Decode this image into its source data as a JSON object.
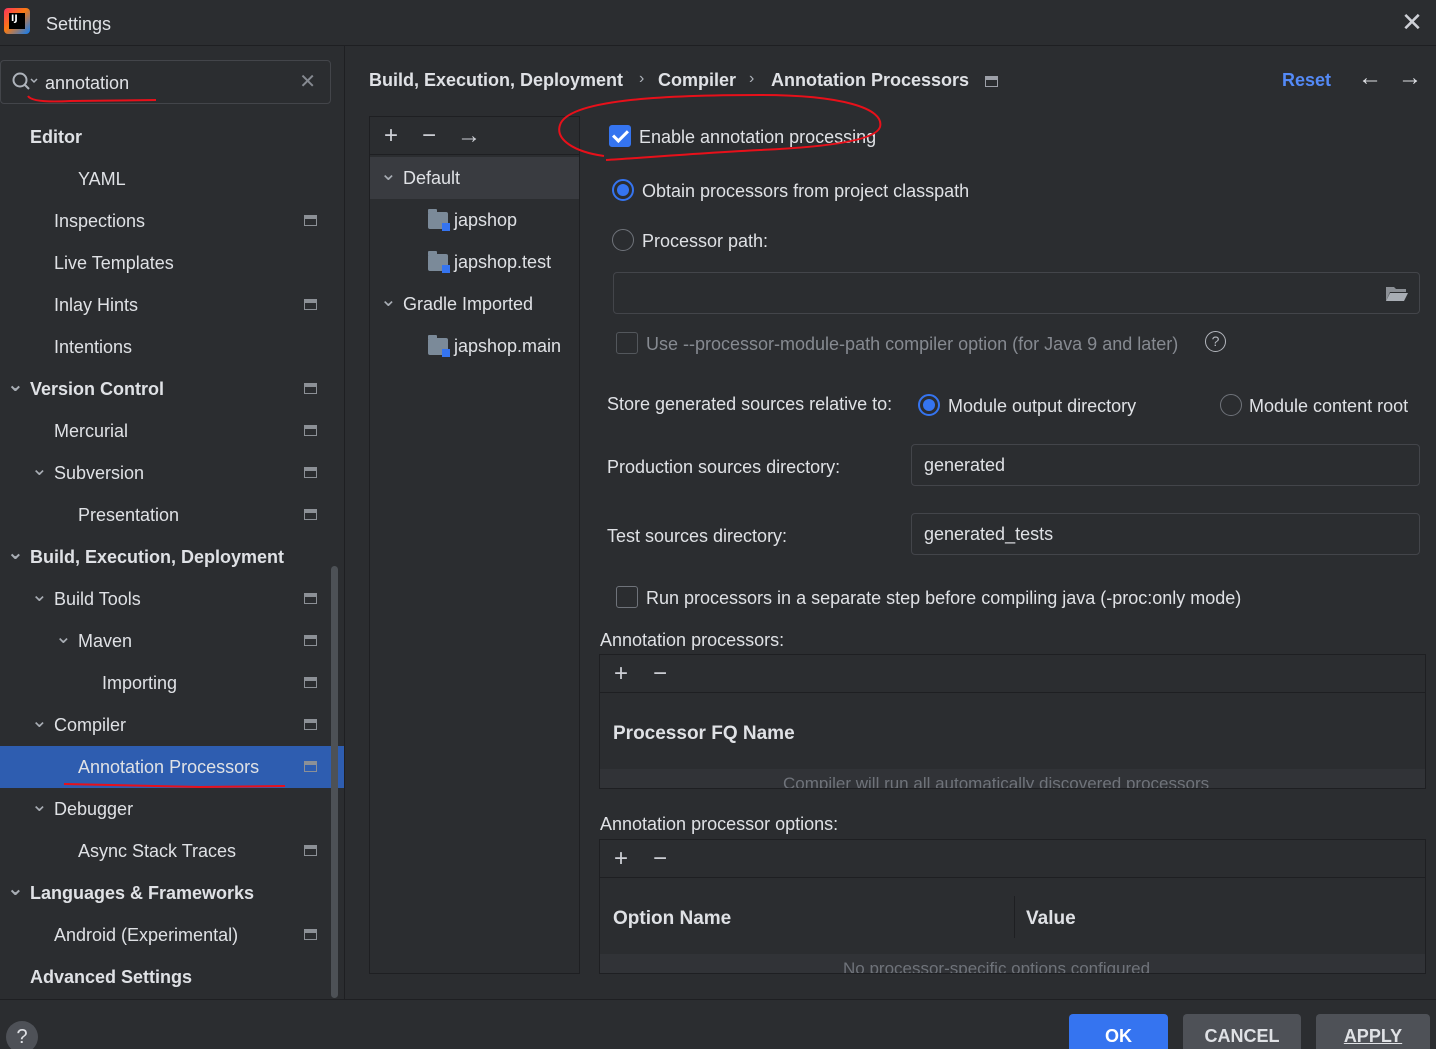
{
  "window": {
    "title": "Settings",
    "app_icon": "intellij-idea-icon"
  },
  "search": {
    "value": "annotation"
  },
  "sidebar": {
    "items": [
      {
        "label": "Editor",
        "bold": true,
        "indent": 0,
        "arrow": false,
        "pin": false
      },
      {
        "label": "YAML",
        "bold": false,
        "indent": 2,
        "arrow": false,
        "pin": false
      },
      {
        "label": "Inspections",
        "bold": false,
        "indent": 1,
        "arrow": false,
        "pin": true
      },
      {
        "label": "Live Templates",
        "bold": false,
        "indent": 1,
        "arrow": false,
        "pin": false
      },
      {
        "label": "Inlay Hints",
        "bold": false,
        "indent": 1,
        "arrow": false,
        "pin": true
      },
      {
        "label": "Intentions",
        "bold": false,
        "indent": 1,
        "arrow": false,
        "pin": false
      },
      {
        "label": "Version Control",
        "bold": true,
        "indent": 0,
        "arrow": true,
        "pin": true
      },
      {
        "label": "Mercurial",
        "bold": false,
        "indent": 1,
        "arrow": false,
        "pin": true
      },
      {
        "label": "Subversion",
        "bold": false,
        "indent": 1,
        "arrow": true,
        "pin": true
      },
      {
        "label": "Presentation",
        "bold": false,
        "indent": 2,
        "arrow": false,
        "pin": true
      },
      {
        "label": "Build, Execution, Deployment",
        "bold": true,
        "indent": 0,
        "arrow": true,
        "pin": false
      },
      {
        "label": "Build Tools",
        "bold": false,
        "indent": 1,
        "arrow": true,
        "pin": true
      },
      {
        "label": "Maven",
        "bold": false,
        "indent": 2,
        "arrow": true,
        "pin": true
      },
      {
        "label": "Importing",
        "bold": false,
        "indent": 3,
        "arrow": false,
        "pin": true
      },
      {
        "label": "Compiler",
        "bold": false,
        "indent": 1,
        "arrow": true,
        "pin": true
      },
      {
        "label": "Annotation Processors",
        "bold": false,
        "indent": 2,
        "arrow": false,
        "pin": true,
        "selected": true
      },
      {
        "label": "Debugger",
        "bold": false,
        "indent": 1,
        "arrow": true,
        "pin": false
      },
      {
        "label": "Async Stack Traces",
        "bold": false,
        "indent": 2,
        "arrow": false,
        "pin": true
      },
      {
        "label": "Languages & Frameworks",
        "bold": true,
        "indent": 0,
        "arrow": true,
        "pin": false
      },
      {
        "label": "Android (Experimental)",
        "bold": false,
        "indent": 1,
        "arrow": false,
        "pin": true
      },
      {
        "label": "Advanced Settings",
        "bold": true,
        "indent": 0,
        "arrow": false,
        "pin": false
      }
    ]
  },
  "breadcrumb": {
    "part1": "Build, Execution, Deployment",
    "part2": "Compiler",
    "part3": "Annotation Processors",
    "sep": "›"
  },
  "header": {
    "reset_label": "Reset",
    "back_icon": "arrow-left-icon",
    "forward_icon": "arrow-right-icon"
  },
  "profiles": {
    "items": [
      {
        "label": "Default",
        "type": "group"
      },
      {
        "label": "japshop",
        "type": "module"
      },
      {
        "label": "japshop.test",
        "type": "module"
      },
      {
        "label": "Gradle Imported",
        "type": "group"
      },
      {
        "label": "japshop.main",
        "type": "module"
      }
    ]
  },
  "settings": {
    "enable_label": "Enable annotation processing",
    "enable_checked": true,
    "classpath_label": "Obtain processors from project classpath",
    "processor_path_label": "Processor path:",
    "processor_path_value": "",
    "module_path_label": "Use --processor-module-path compiler option (for Java 9 and later)",
    "store_label": "Store generated sources relative to:",
    "module_output_label": "Module output directory",
    "module_content_label": "Module content root",
    "production_label": "Production sources directory:",
    "production_value": "generated",
    "test_label": "Test sources directory:",
    "test_value": "generated_tests",
    "run_separate_label": "Run processors in a separate step before compiling java (-proc:only mode)",
    "processors_section": "Annotation processors:",
    "processors_col": "Processor FQ Name",
    "processors_empty": "Compiler will run all automatically discovered processors",
    "options_section": "Annotation processor options:",
    "options_col_name": "Option Name",
    "options_col_value": "Value",
    "options_empty": "No processor-specific options configured"
  },
  "footer": {
    "ok_label": "OK",
    "cancel_label": "CANCEL",
    "apply_label": "APPLY",
    "help_label": "?"
  },
  "colors": {
    "accent": "#3574f0",
    "selection": "#2e5db0",
    "link": "#548af7",
    "annotation_red": "#e8101a",
    "background": "#2b2d30"
  }
}
